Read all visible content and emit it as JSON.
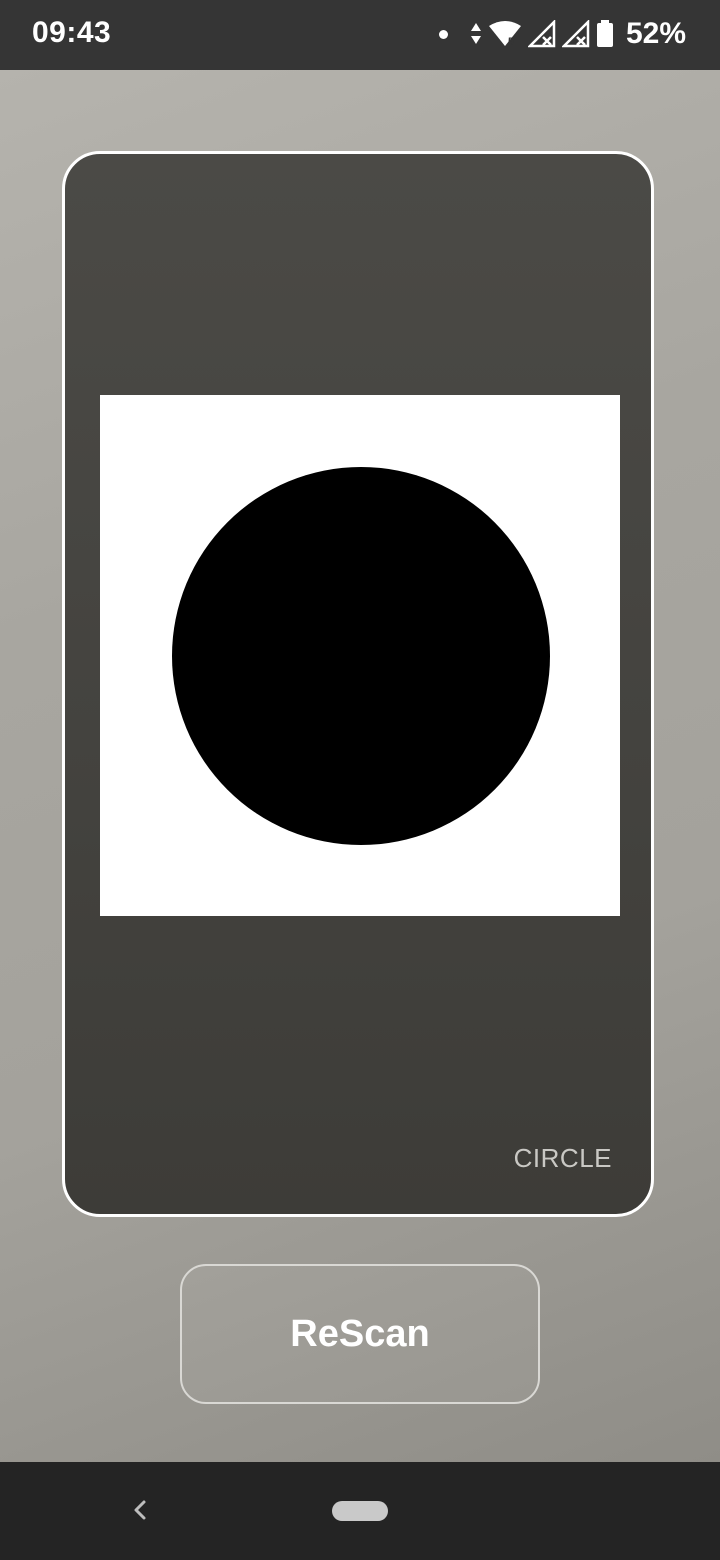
{
  "status_bar": {
    "time": "09:43",
    "battery_percent": "52%",
    "icons": [
      "notification-dot-icon",
      "data-arrows-icon",
      "wifi-icon",
      "signal-no-service-icon",
      "signal-no-service-icon",
      "battery-icon"
    ],
    "wifi_badge": "5"
  },
  "scan": {
    "detected_shape": "circle",
    "shape_label": "CIRCLE",
    "image_background": "#ffffff",
    "shape_color": "#000000"
  },
  "actions": {
    "rescan_label": "ReScan"
  },
  "navigation": {
    "back_icon": "back-chevron-icon",
    "home_icon": "home-pill-icon"
  }
}
